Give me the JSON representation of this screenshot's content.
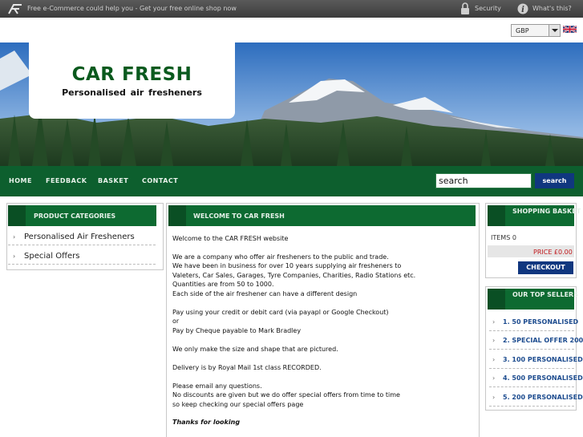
{
  "topbar": {
    "promo": "Free e-Commerce could help you - Get your free online shop now",
    "security_label": "Security",
    "whats_this_label": "What's this?",
    "icons": [
      "shop-logo-icon",
      "lock-icon",
      "info-icon"
    ]
  },
  "currency": {
    "selected": "GBP",
    "flag": "uk-flag-icon"
  },
  "header": {
    "title": "CAR FRESH",
    "subtitle": "Personalised air fresheners"
  },
  "nav": {
    "items": [
      "HOME",
      "FEEDBACK",
      "BASKET",
      "CONTACT"
    ],
    "search_value": "search",
    "search_button": "search"
  },
  "categories": {
    "title": "PRODUCT CATEGORIES",
    "items": [
      "Personalised Air Fresheners",
      "Special Offers"
    ]
  },
  "main": {
    "title": "WELCOME TO CAR FRESH",
    "lines": [
      "Welcome to the CAR FRESH website",
      "We are a company who offer air fresheners to the public and trade.",
      "We have been in business for over 10 years supplying air fresheners to",
      "Valeters, Car Sales, Garages, Tyre Companies, Charities, Radio Stations etc.",
      "Quantities are from 50 to 1000.",
      "Each side of the air freshener can have a different design",
      "Pay using your credit or debit card (via payapl or Google Checkout)",
      "or",
      "Pay by Cheque payable to Mark Bradley",
      "We only make the size and shape that are pictured.",
      "Delivery is by Royal Mail 1st class RECORDED.",
      "Please email any questions.",
      "No discounts are given but we do offer special offers from time to time",
      "so keep checking our special offers page",
      "Thanks for looking"
    ]
  },
  "basket": {
    "title": "SHOPPING BASKET",
    "items_label": "ITEMS 0",
    "price_label": "PRICE £0.00",
    "checkout": "CHECKOUT"
  },
  "top_sellers": {
    "title": "OUR TOP SELLERS",
    "items": [
      "1. 50 PERSONALISED",
      "2. SPECIAL OFFER 200",
      "3. 100 PERSONALISED",
      "4. 500 PERSONALISED",
      "5. 200 PERSONALISED"
    ]
  },
  "colors": {
    "green": "#0d6a31",
    "dark_green": "#0a4f24",
    "blue_button": "#10377f",
    "price_red": "#c0161a"
  }
}
